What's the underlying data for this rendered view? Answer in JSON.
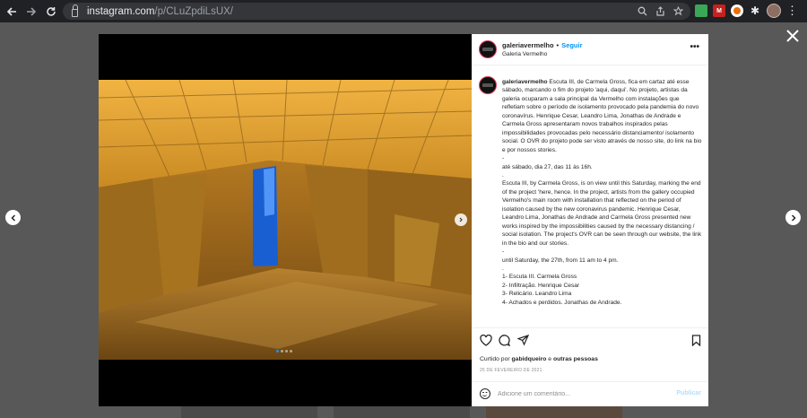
{
  "browser": {
    "url_host": "instagram.com",
    "url_path": "/p/CLuZpdiLsUX/",
    "ext_red_label": "M"
  },
  "post": {
    "username": "galeriavermelho",
    "follow_label": "Seguir",
    "location": "Galeria Vermelho",
    "caption_username": "galeriavermelho",
    "caption_text": " Escuta III, de Carmela Gross, fica em cartaz até esse sábado, marcando o fim do projeto 'aqui, daqui'. No projeto, artistas da galeria ocuparam a sala principal da Vermelho com instalações que refletiam sobre o período de isolamento provocado pela pandemia do novo coronavírus. Henrique Cesar, Leandro Lima, Jonathas de Andrade e Carmela Gross apresentaram novos trabalhos inspirados pelas impossibilidades provocadas pelo necessário distanciamento/ isolamento social. O OVR do projeto pode ser visto através de nosso site, do link na bio e por nossos stories.\n-\naté sábado, dia 27, das 11 às 16h.\n.\nEscuta III, by Carmela Gross, is on view until this Saturday, marking the end of the project 'here, hence. In the project, artists from the gallery occupied Vermelho's main room with installation that reflected on the period of isolation caused by the new coronavirus pandemic. Henrique Cesar, Leandro Lima, Jonathas de Andrade and Carmela Gross presented new works inspired by the impossibilities caused by the necessary distancing / social isolation. The project's OVR can be seen through our website, the link in the bio and our stories.\n-\nuntil Saturday, the 27th, from 11 am to 4 pm.\n.\n1- Escuta III. Carmela Gross\n2- Infiltração. Henrique Cesar\n3- Relicário. Leandro Lima\n4- Achados e perdidos. Jonathas de Andrade.",
    "liked_by_prefix": "Curtido por ",
    "liked_by_user": "gabidqueiro",
    "liked_by_mid": " e ",
    "liked_by_others": "outras pessoas",
    "date": "25 DE FEVEREIRO DE 2021",
    "comment_placeholder": "Adicione um comentário...",
    "publish_label": "Publicar",
    "carousel_dots": 4,
    "carousel_active": 1
  },
  "icons": {
    "back": "arrow-left-icon",
    "forward": "arrow-right-icon",
    "reload": "reload-icon",
    "like": "heart-icon",
    "comment": "comment-icon",
    "share": "share-icon",
    "save": "bookmark-icon"
  },
  "colors": {
    "accent": "#0095f6",
    "publish_disabled": "#b2dffc",
    "avatar_ring": "#d93a5b",
    "overlay": "#585858"
  }
}
